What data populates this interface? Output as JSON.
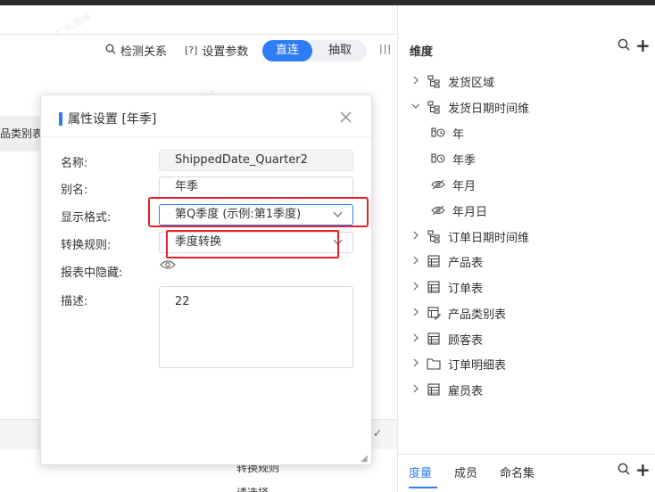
{
  "toolbar": {
    "check_label": "检测关系",
    "params_label": "设置参数",
    "mode_on": "直连",
    "mode_off": "抽取"
  },
  "background": {
    "cell_text": "品类别表",
    "row_text1": "转换规则",
    "row_text2": "请选择"
  },
  "dialog": {
    "title": "属性设置 [年季]",
    "fields": {
      "name_label": "名称:",
      "name_value": "ShippedDate_Quarter2",
      "alias_label": "别名:",
      "alias_value": "年季",
      "format_label": "显示格式:",
      "format_value": "第Q季度 (示例:第1季度)",
      "rule_label": "转换规则:",
      "rule_value": "季度转换",
      "hidden_label": "报表中隐藏:",
      "desc_label": "描述:",
      "desc_value": "22"
    }
  },
  "dimension_panel": {
    "title": "维度",
    "items": [
      {
        "label": "发货区域",
        "icon": "hierarchy-icon",
        "level": 0,
        "expanded": false
      },
      {
        "label": "发货日期时间维",
        "icon": "hierarchy-icon",
        "level": 0,
        "expanded": true
      },
      {
        "label": "年",
        "icon": "date-level-icon",
        "level": 1
      },
      {
        "label": "年季",
        "icon": "date-level-icon",
        "level": 1
      },
      {
        "label": "年月",
        "icon": "hidden-eye-icon",
        "level": 1
      },
      {
        "label": "年月日",
        "icon": "hidden-eye-icon",
        "level": 1
      },
      {
        "label": "订单日期时间维",
        "icon": "hierarchy-icon",
        "level": 0,
        "expanded": false
      },
      {
        "label": "产品表",
        "icon": "table-icon",
        "level": 0,
        "expanded": false
      },
      {
        "label": "订单表",
        "icon": "table-icon",
        "level": 0,
        "expanded": false
      },
      {
        "label": "产品类别表",
        "icon": "table-edit-icon",
        "level": 0,
        "expanded": false
      },
      {
        "label": "顾客表",
        "icon": "table-icon",
        "level": 0,
        "expanded": false
      },
      {
        "label": "订单明细表",
        "icon": "folder-icon",
        "level": 0,
        "expanded": false
      },
      {
        "label": "雇员表",
        "icon": "table-icon",
        "level": 0,
        "expanded": false
      }
    ]
  },
  "bottom_tabs": [
    {
      "label": "度量",
      "active": true
    },
    {
      "label": "成员",
      "active": false
    },
    {
      "label": "命名集",
      "active": false
    }
  ],
  "colors": {
    "accent": "#2e7cf6",
    "highlight": "#e8202a"
  }
}
